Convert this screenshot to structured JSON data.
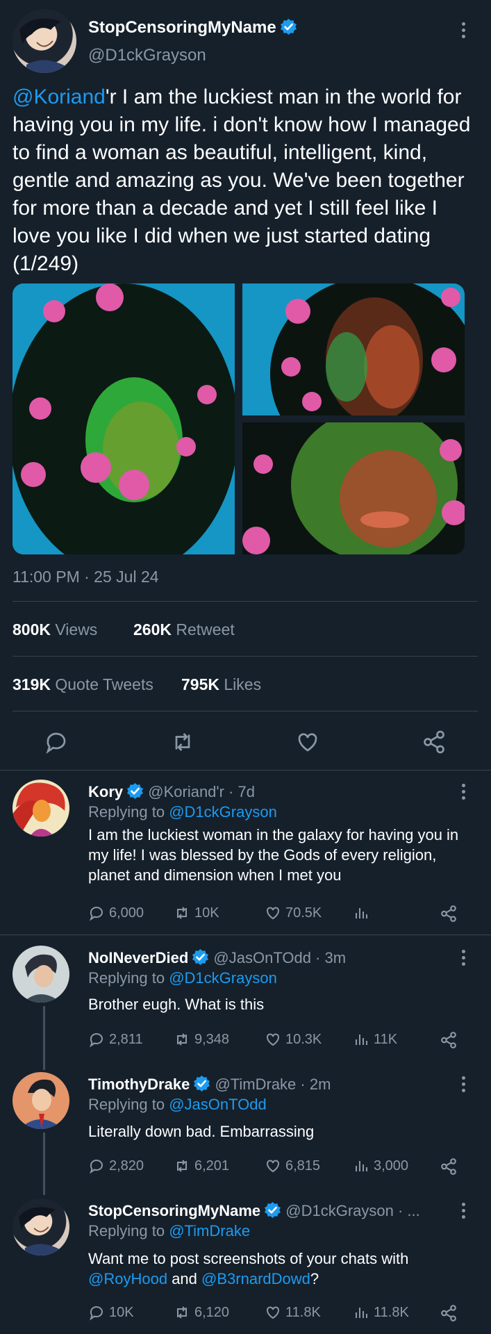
{
  "main_tweet": {
    "display_name": "StopCensoringMyName",
    "handle": "@D1ckGrayson",
    "mention": "@Koriand",
    "text_after_mention": "'r I am the luckiest man in the world for having you in my life. i don't know how I managed to find a woman as beautiful, intelligent, kind, gentle and amazing as you. We've been together for more than a decade and yet I still feel like I love you like I did when we just started dating (1/249)",
    "timestamp": "11:00 PM · 25 Jul 24",
    "views_count": "800K",
    "views_label": "Views",
    "retweets_count": "260K",
    "retweets_label": "Retweet",
    "quotes_count": "319K",
    "quotes_label": "Quote Tweets",
    "likes_count": "795K",
    "likes_label": "Likes"
  },
  "replies": [
    {
      "display_name": "Kory",
      "meta": "@Koriand'r · 7d",
      "replying_label": "Replying to",
      "replying_to": "@D1ckGrayson",
      "text": "I am the luckiest woman in the galaxy for having you in my life! I was blessed by the Gods of every religion, planet and dimension when I met you",
      "replies": "6,000",
      "retweets": "10K",
      "likes": "70.5K",
      "views": ""
    },
    {
      "display_name": "NoINeverDied",
      "meta": "@JasOnTOdd · 3m",
      "replying_label": "Replying to",
      "replying_to": "@D1ckGrayson",
      "text": "Brother eugh. What is this",
      "replies": "2,811",
      "retweets": "9,348",
      "likes": "10.3K",
      "views": "11K"
    },
    {
      "display_name": "TimothyDrake",
      "meta": "@TimDrake · 2m",
      "replying_label": "Replying to",
      "replying_to": "@JasOnTOdd",
      "text": "Literally down bad. Embarrassing",
      "replies": "2,820",
      "retweets": "6,201",
      "likes": "6,815",
      "views": "3,000"
    },
    {
      "display_name": "StopCensoringMyName",
      "meta": "@D1ckGrayson · ...",
      "replying_label": "Replying to",
      "replying_to": "@TimDrake",
      "text_before": "Want me to post screenshots of your chats with",
      "mention1": "@RoyHood",
      "and_word": "and",
      "mention2": "@B3rnardDowd",
      "end": "?",
      "replies": "10K",
      "retweets": "6,120",
      "likes": "11.8K",
      "views": "11.8K"
    }
  ],
  "icons": [
    "reply-icon",
    "retweet-icon",
    "like-icon",
    "share-icon",
    "views-icon",
    "more-icon",
    "verified-badge-icon"
  ],
  "colors": {
    "background": "#15202b",
    "accent": "#1d9bf0",
    "muted": "#8b98a5",
    "divider": "#38444d"
  }
}
